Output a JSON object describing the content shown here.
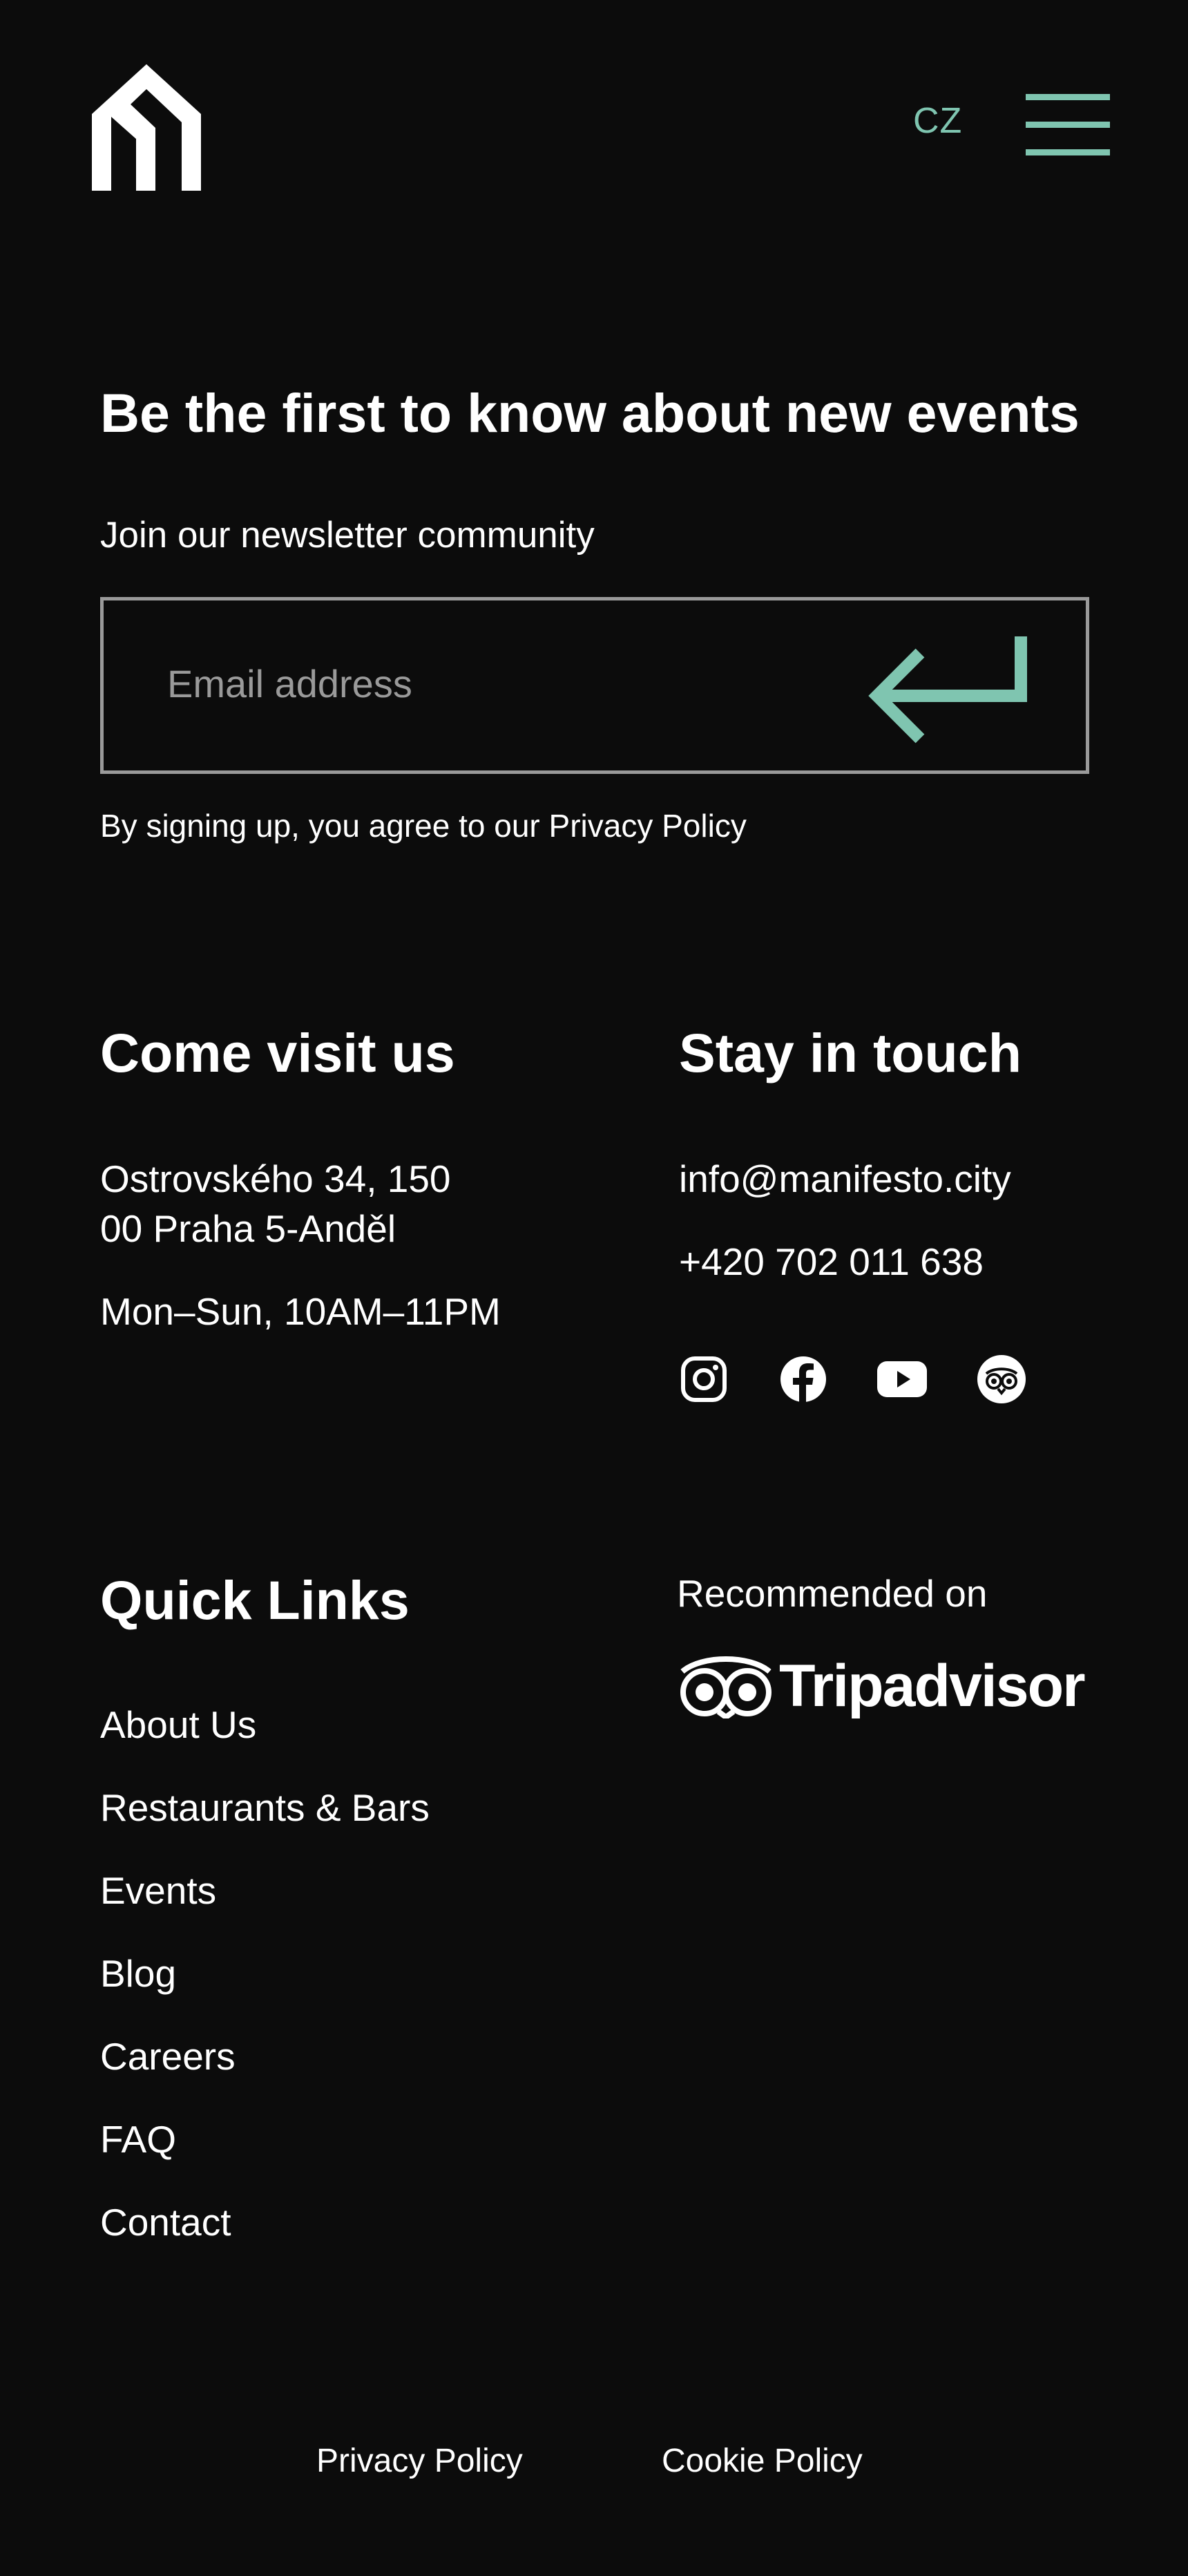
{
  "header": {
    "logo": "manifesto-logo",
    "language_label": "CZ",
    "menu_icon": "hamburger-menu-icon"
  },
  "newsletter": {
    "title": "Be the first to know about new events",
    "subtitle": "Join our newsletter community",
    "email_placeholder": "Email address",
    "email_value": "",
    "submit_icon": "enter-arrow-icon",
    "legal_text": "By signing up, you agree to our Privacy Policy"
  },
  "visit": {
    "title": "Come visit us",
    "address_line1": "Ostrovského 34, 150",
    "address_line2": "00 Praha 5-Anděl",
    "hours": "Mon–Sun, 10AM–11PM"
  },
  "contact": {
    "title": "Stay in touch",
    "email": "info@manifesto.city",
    "phone": "+420 702 011 638",
    "social": [
      {
        "icon": "instagram-icon"
      },
      {
        "icon": "facebook-icon"
      },
      {
        "icon": "youtube-icon"
      },
      {
        "icon": "tripadvisor-icon"
      }
    ]
  },
  "quick_links": {
    "title": "Quick Links",
    "items": [
      {
        "label": "About Us"
      },
      {
        "label": "Restaurants & Bars"
      },
      {
        "label": "Events"
      },
      {
        "label": "Blog"
      },
      {
        "label": "Careers"
      },
      {
        "label": "FAQ"
      },
      {
        "label": "Contact"
      }
    ]
  },
  "recommended": {
    "label": "Recommended on",
    "brand": "Tripadvisor"
  },
  "footer": {
    "privacy_policy": "Privacy Policy",
    "cookie_policy": "Cookie Policy"
  },
  "colors": {
    "background": "#0c0c0c",
    "accent": "#7fc5b0",
    "text": "#ffffff",
    "border": "#9a9a9a"
  }
}
